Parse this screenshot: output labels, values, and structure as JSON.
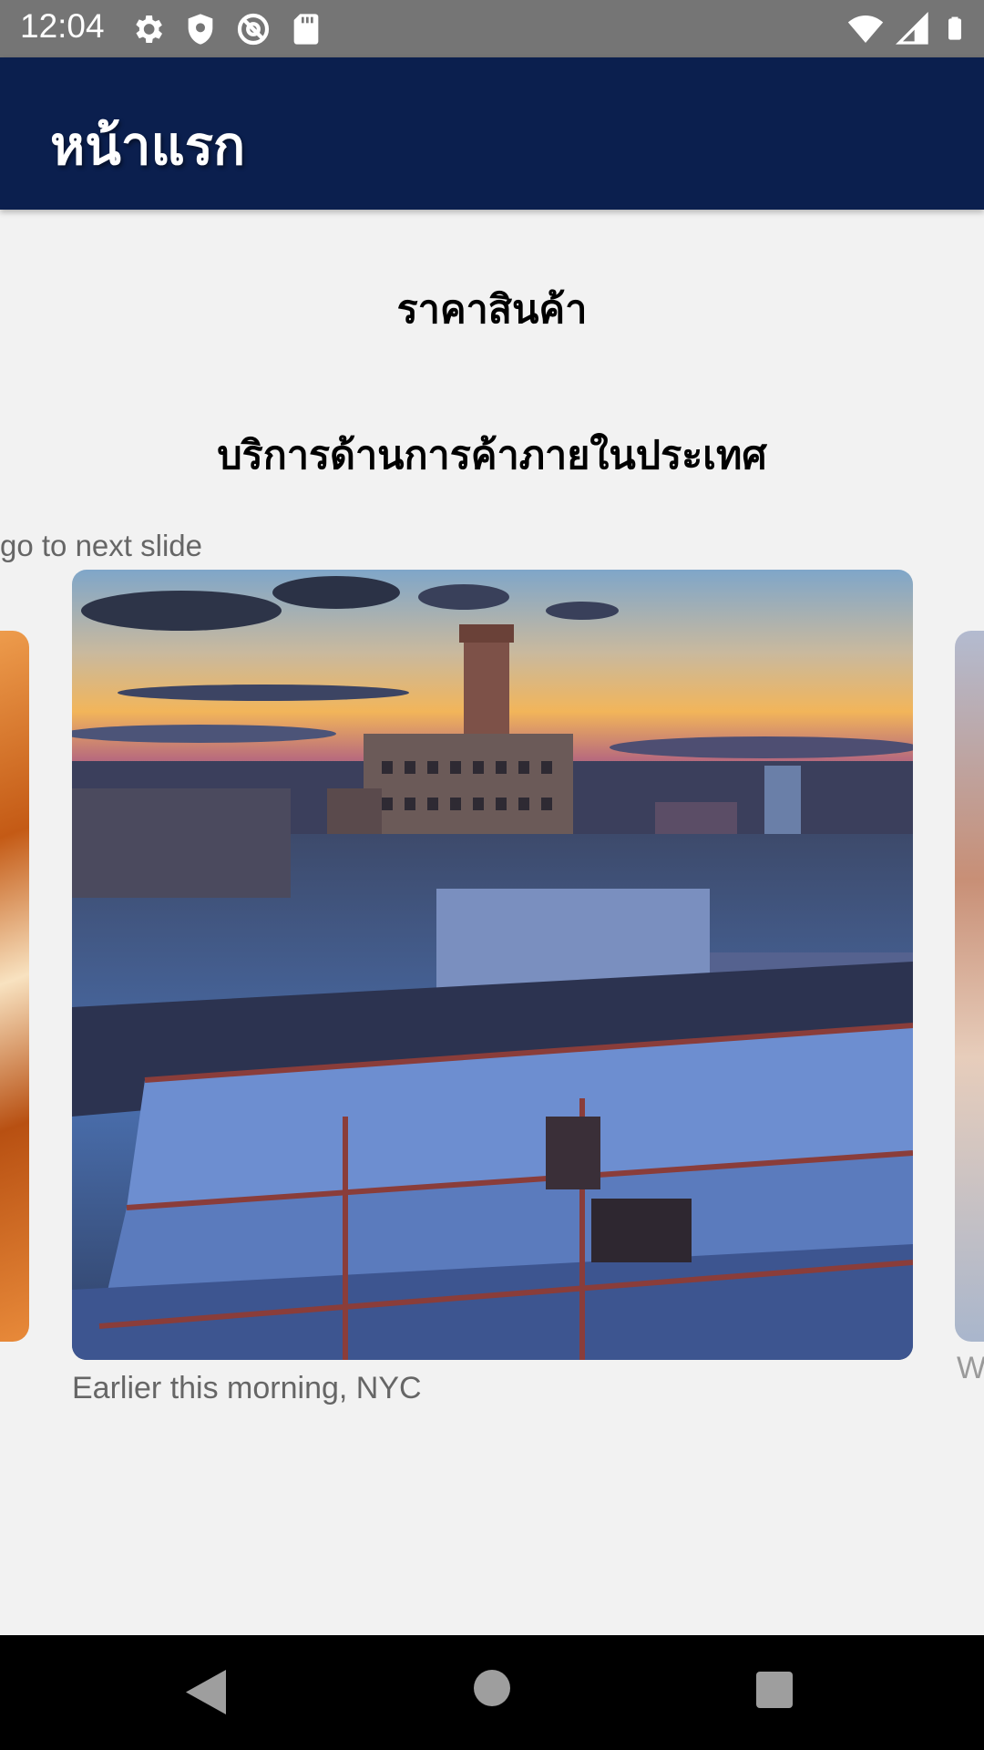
{
  "status_bar": {
    "time": "12:04",
    "left_icons": [
      "gear-icon",
      "shield-icon",
      "at-sign-icon",
      "sd-card-icon"
    ],
    "right_icons": [
      "wifi-icon",
      "signal-icon",
      "battery-icon"
    ]
  },
  "app_bar": {
    "title": "หน้าแรก"
  },
  "content": {
    "heading_price": "ราคาสินค้า",
    "heading_service": "บริการด้านการค้าภายในประเทศ",
    "carousel_hint": "go to next slide"
  },
  "carousel": {
    "current_caption": "Earlier this morning, NYC",
    "next_caption_partial": "W"
  },
  "colors": {
    "app_bar": "#0b1f4e",
    "status_bar": "#757575",
    "background": "#f2f2f2"
  }
}
